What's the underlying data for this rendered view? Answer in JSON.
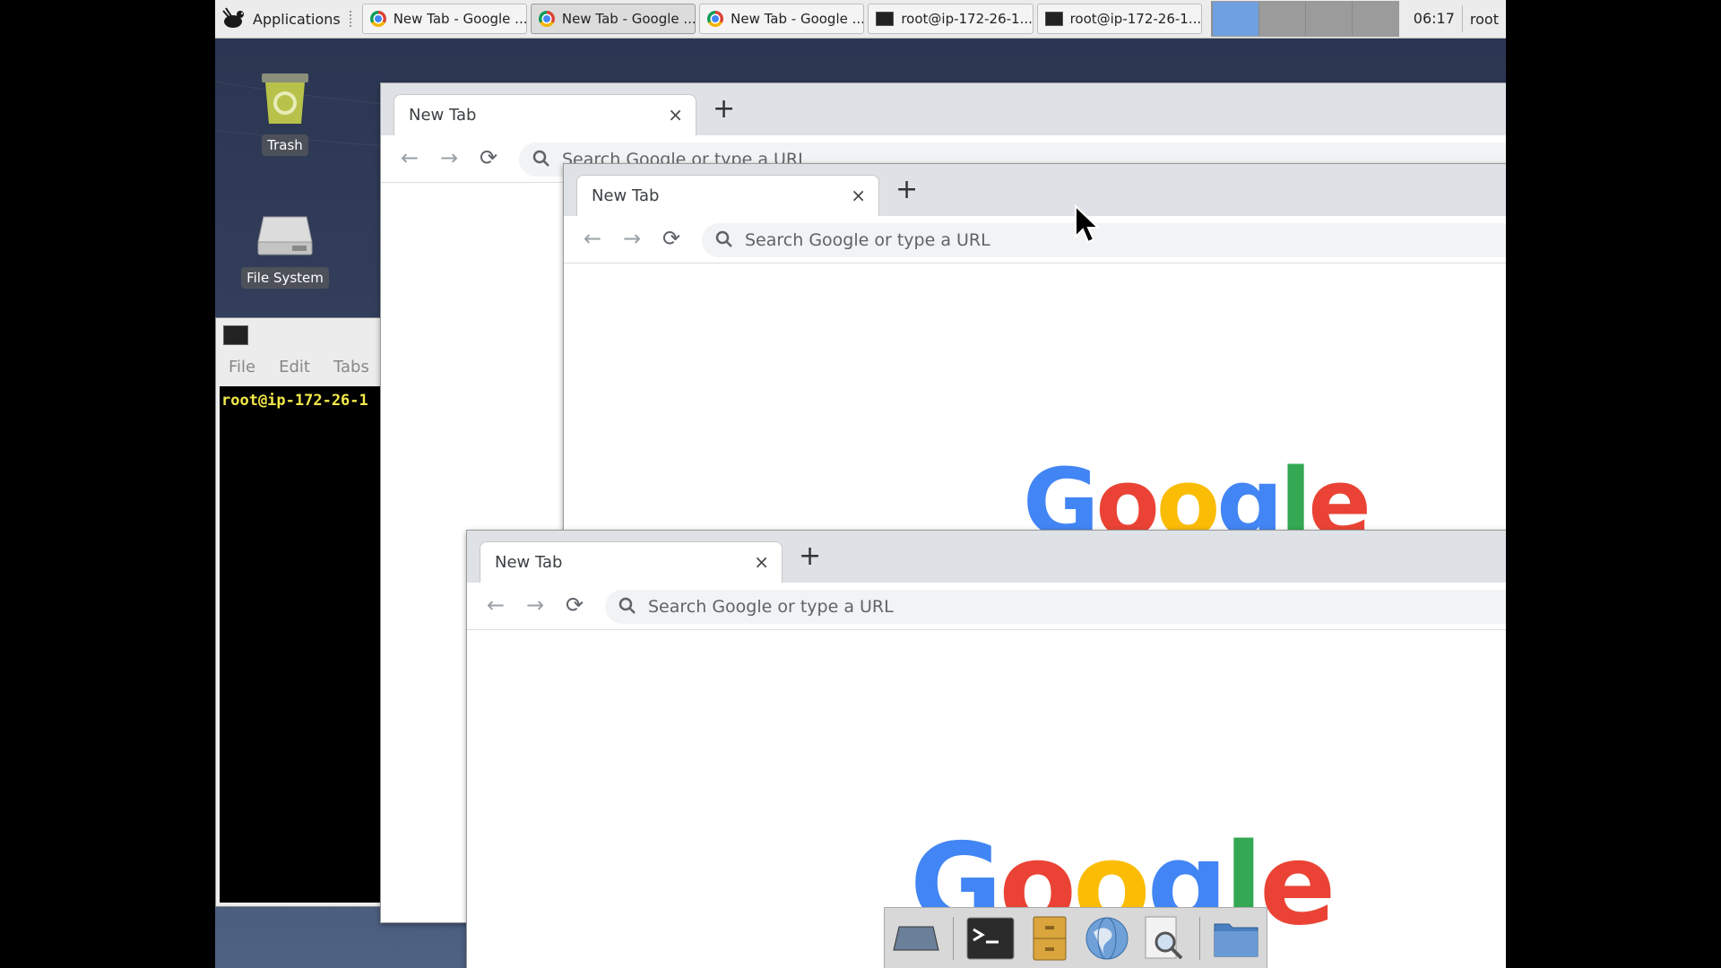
{
  "panel": {
    "applications_label": "Applications",
    "tasks": [
      {
        "label": "New Tab - Google ...",
        "icon": "chrome-icon",
        "active": false
      },
      {
        "label": "New Tab - Google ...",
        "icon": "chrome-icon",
        "active": true
      },
      {
        "label": "New Tab - Google ...",
        "icon": "chrome-icon",
        "active": false
      },
      {
        "label": "root@ip-172-26-1...",
        "icon": "terminal-icon",
        "active": false
      },
      {
        "label": "root@ip-172-26-1...",
        "icon": "terminal-icon",
        "active": false
      }
    ],
    "clock": "06:17",
    "user": "root"
  },
  "desktop": {
    "trash_label": "Trash",
    "filesystem_label": "File System"
  },
  "terminal": {
    "menu": [
      "File",
      "Edit",
      "Tabs"
    ],
    "prompt": "root@ip-172-26-1"
  },
  "browser": {
    "tab_title": "New Tab",
    "tab_close": "×",
    "new_tab": "+",
    "omnibox_placeholder": "Search Google or type a URL",
    "logo_text": "Google"
  },
  "dock": {
    "items": [
      "show-desktop-icon",
      "terminal-icon",
      "file-cabinet-icon",
      "web-browser-icon",
      "search-app-icon",
      "folder-icon"
    ]
  },
  "colors": {
    "google_blue": "#4285f4",
    "google_red": "#ea4335",
    "google_yellow": "#fbbc05",
    "google_green": "#34a853",
    "terminal_prompt": "#f2e84b"
  }
}
